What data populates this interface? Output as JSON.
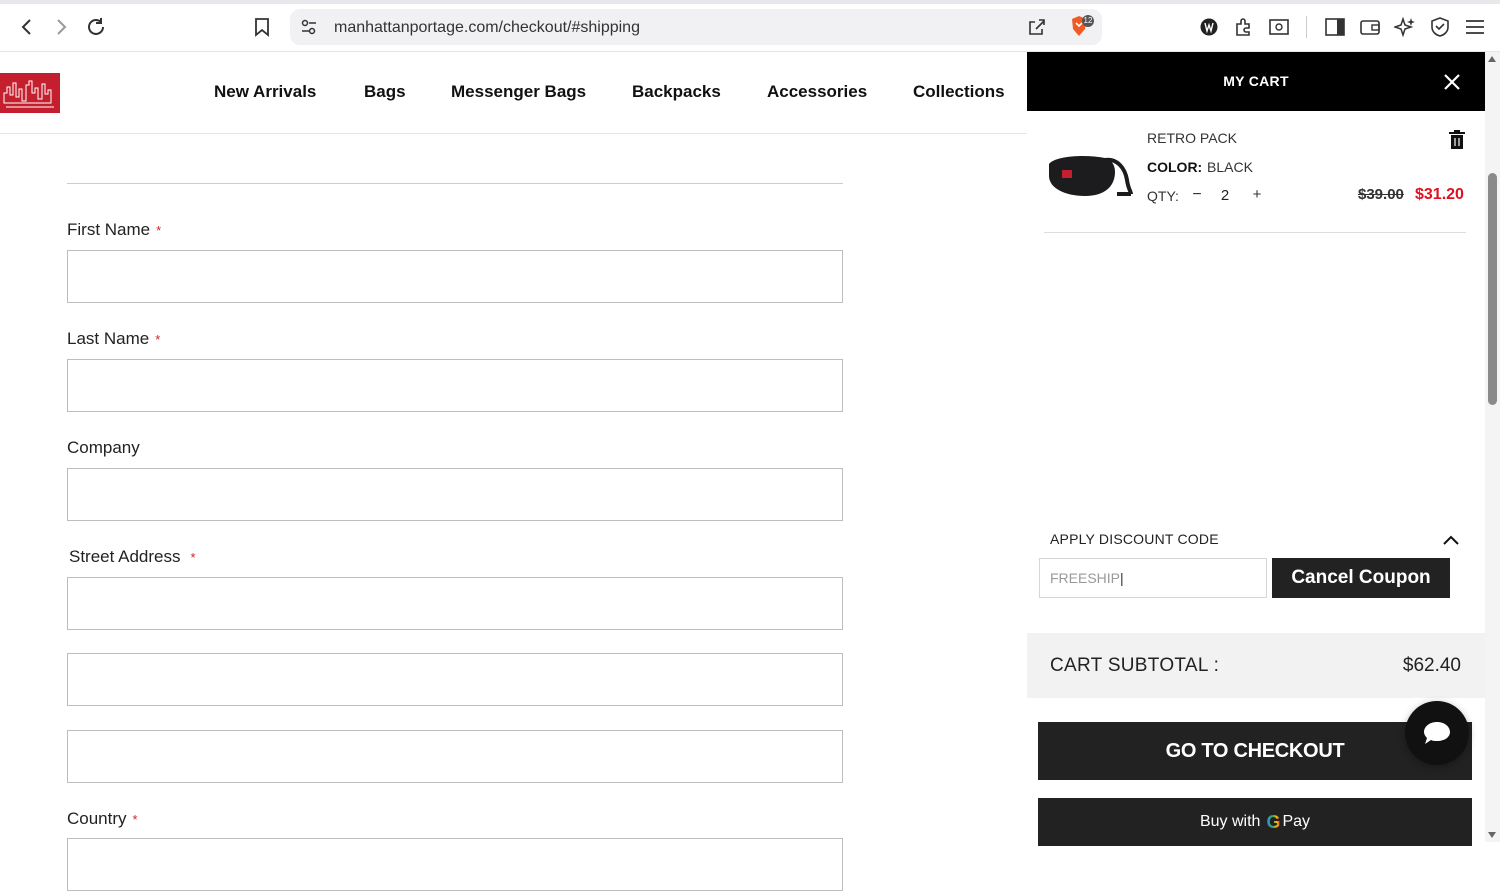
{
  "browser": {
    "url": "manhattanportage.com/checkout/#shipping",
    "brave_badge_count": "12"
  },
  "header": {
    "menu": [
      "New Arrivals",
      "Bags",
      "Messenger Bags",
      "Backpacks",
      "Accessories",
      "Collections"
    ]
  },
  "form": {
    "fields": [
      {
        "label": "First Name",
        "required": "*"
      },
      {
        "label": "Last Name",
        "required": "*"
      },
      {
        "label": "Company",
        "required": ""
      },
      {
        "label": "Street Address",
        "required": "*"
      },
      {
        "label": "Country",
        "required": "*"
      }
    ]
  },
  "cart": {
    "title": "MY CART",
    "item": {
      "name": "RETRO PACK",
      "color_label": "COLOR:",
      "color": "BLACK",
      "qty_label": "QTY:",
      "qty_minus": "−",
      "qty": "2",
      "qty_plus": "+",
      "old_price": "$39.00",
      "new_price": "$31.20"
    },
    "discount_label": "APPLY DISCOUNT CODE",
    "coupon_value": "FREESHIP",
    "cancel_coupon": "Cancel Coupon",
    "subtotal_label": "CART SUBTOTAL :",
    "subtotal_value": "$62.40",
    "checkout_label": "GO TO CHECKOUT",
    "gpay_prefix": "Buy with",
    "gpay_g": "G",
    "gpay_suffix": "Pay"
  },
  "colors": {
    "brand_red": "#c41f2e",
    "sale_red": "#e1101f",
    "dark": "#222222"
  }
}
